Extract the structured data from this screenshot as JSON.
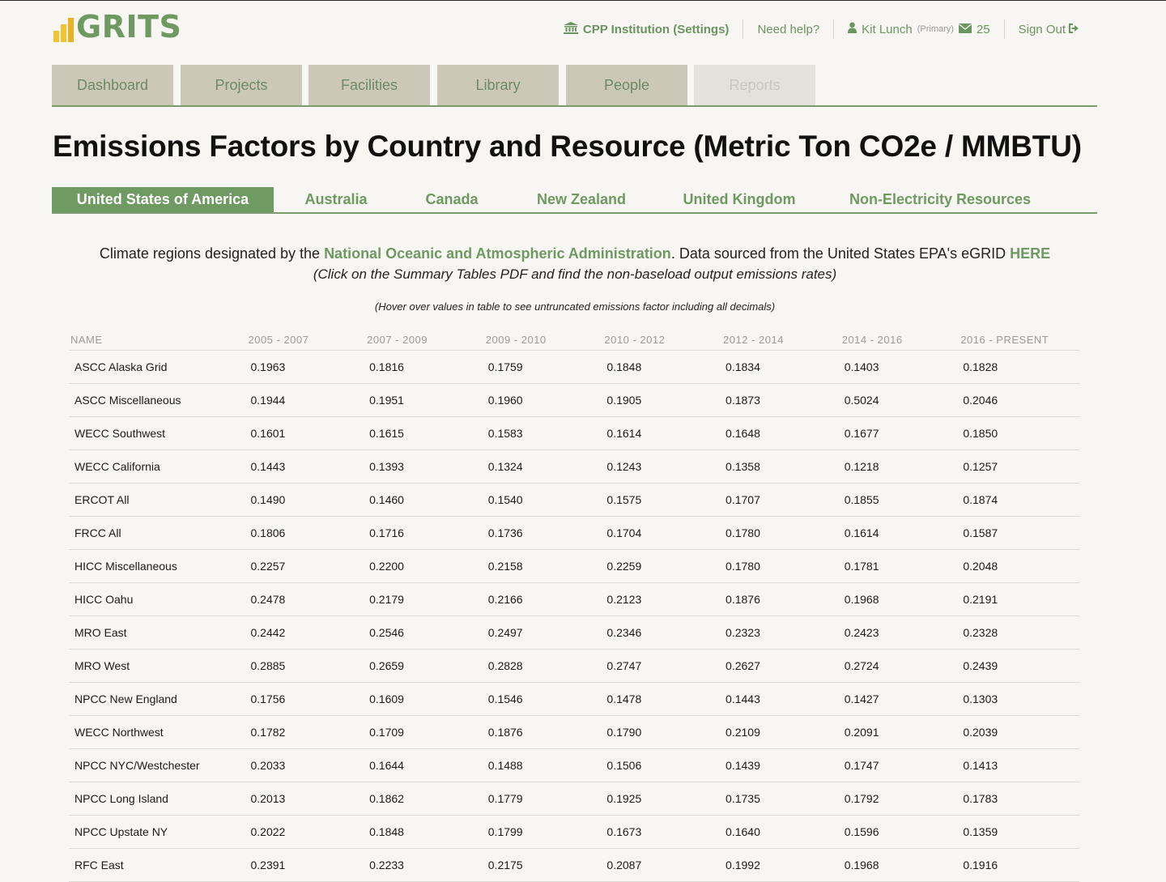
{
  "logo": {
    "text": "GRITS"
  },
  "topnav": {
    "institution": "CPP Institution (Settings)",
    "help": "Need help?",
    "user_name": "Kit Lunch",
    "user_role": "(Primary)",
    "messages_count": "25",
    "sign_out": "Sign Out"
  },
  "tabs": [
    {
      "label": "Dashboard"
    },
    {
      "label": "Projects"
    },
    {
      "label": "Facilities"
    },
    {
      "label": "Library"
    },
    {
      "label": "People"
    },
    {
      "label": "Reports"
    }
  ],
  "page_title": "Emissions Factors by Country and Resource (Metric Ton CO2e / MMBTU)",
  "subtabs": [
    {
      "label": "United States of America"
    },
    {
      "label": "Australia"
    },
    {
      "label": "Canada"
    },
    {
      "label": "New Zealand"
    },
    {
      "label": "United Kingdom"
    },
    {
      "label": "Non-Electricity Resources"
    }
  ],
  "intro": {
    "prefix": "Climate regions designated by the ",
    "noaa_link": "National Oceanic and Atmospheric Administration",
    "middle": ". Data sourced from the United States EPA's eGRID ",
    "here_link": "HERE",
    "note": "(Click on the Summary Tables PDF and find the non-baseload output emissions rates)",
    "hover_note": "(Hover over values in table to see untruncated emissions factor including all decimals)"
  },
  "table": {
    "headers": [
      "NAME",
      "2005 - 2007",
      "2007 - 2009",
      "2009 - 2010",
      "2010 - 2012",
      "2012 - 2014",
      "2014 - 2016",
      "2016 - PRESENT"
    ],
    "rows": [
      [
        "ASCC Alaska Grid",
        "0.1963",
        "0.1816",
        "0.1759",
        "0.1848",
        "0.1834",
        "0.1403",
        "0.1828"
      ],
      [
        "ASCC Miscellaneous",
        "0.1944",
        "0.1951",
        "0.1960",
        "0.1905",
        "0.1873",
        "0.5024",
        "0.2046"
      ],
      [
        "WECC Southwest",
        "0.1601",
        "0.1615",
        "0.1583",
        "0.1614",
        "0.1648",
        "0.1677",
        "0.1850"
      ],
      [
        "WECC California",
        "0.1443",
        "0.1393",
        "0.1324",
        "0.1243",
        "0.1358",
        "0.1218",
        "0.1257"
      ],
      [
        "ERCOT All",
        "0.1490",
        "0.1460",
        "0.1540",
        "0.1575",
        "0.1707",
        "0.1855",
        "0.1874"
      ],
      [
        "FRCC All",
        "0.1806",
        "0.1716",
        "0.1736",
        "0.1704",
        "0.1780",
        "0.1614",
        "0.1587"
      ],
      [
        "HICC Miscellaneous",
        "0.2257",
        "0.2200",
        "0.2158",
        "0.2259",
        "0.1780",
        "0.1781",
        "0.2048"
      ],
      [
        "HICC Oahu",
        "0.2478",
        "0.2179",
        "0.2166",
        "0.2123",
        "0.1876",
        "0.1968",
        "0.2191"
      ],
      [
        "MRO East",
        "0.2442",
        "0.2546",
        "0.2497",
        "0.2346",
        "0.2323",
        "0.2423",
        "0.2328"
      ],
      [
        "MRO West",
        "0.2885",
        "0.2659",
        "0.2828",
        "0.2747",
        "0.2627",
        "0.2724",
        "0.2439"
      ],
      [
        "NPCC New England",
        "0.1756",
        "0.1609",
        "0.1546",
        "0.1478",
        "0.1443",
        "0.1427",
        "0.1303"
      ],
      [
        "WECC Northwest",
        "0.1782",
        "0.1709",
        "0.1876",
        "0.1790",
        "0.2109",
        "0.2091",
        "0.2039"
      ],
      [
        "NPCC NYC/Westchester",
        "0.2033",
        "0.1644",
        "0.1488",
        "0.1506",
        "0.1439",
        "0.1747",
        "0.1413"
      ],
      [
        "NPCC Long Island",
        "0.2013",
        "0.1862",
        "0.1779",
        "0.1925",
        "0.1735",
        "0.1792",
        "0.1783"
      ],
      [
        "NPCC Upstate NY",
        "0.2022",
        "0.1848",
        "0.1799",
        "0.1673",
        "0.1640",
        "0.1596",
        "0.1359"
      ],
      [
        "RFC East",
        "0.2391",
        "0.2233",
        "0.2175",
        "0.2087",
        "0.1992",
        "0.1968",
        "0.1916"
      ]
    ]
  },
  "colors": {
    "brand_green": "#6e9a62",
    "logo_yellow": "#f2c230",
    "tab_bg": "#cbc8b8",
    "page_bg": "#f8f6f2"
  }
}
